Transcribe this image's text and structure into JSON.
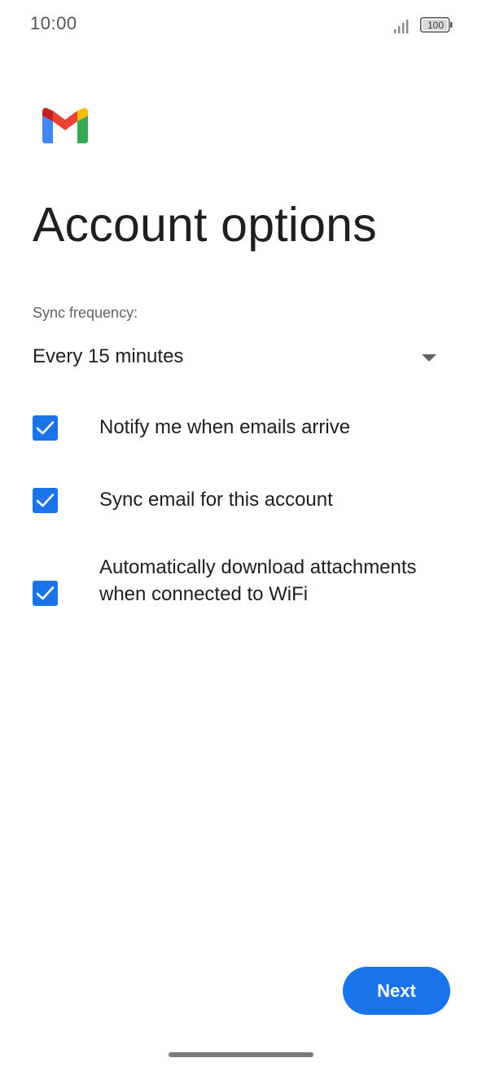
{
  "status_bar": {
    "time": "10:00",
    "battery_level": "100",
    "icons": [
      "signal-icon",
      "battery-icon"
    ]
  },
  "logo": {
    "icon": "gmail-logo-icon"
  },
  "title": "Account options",
  "sync": {
    "label": "Sync frequency:",
    "selected_value": "Every 15 minutes",
    "icon": "dropdown-arrow-icon"
  },
  "options": [
    {
      "label": "Notify me when emails arrive",
      "checked": true
    },
    {
      "label": "Sync email for this account",
      "checked": true
    },
    {
      "label": "Automatically download attachments when connected to WiFi",
      "checked": true
    }
  ],
  "actions": {
    "next_label": "Next"
  },
  "colors": {
    "accent": "#1a73e8",
    "text_primary": "#1f1f1f",
    "text_secondary": "#5f6368"
  }
}
